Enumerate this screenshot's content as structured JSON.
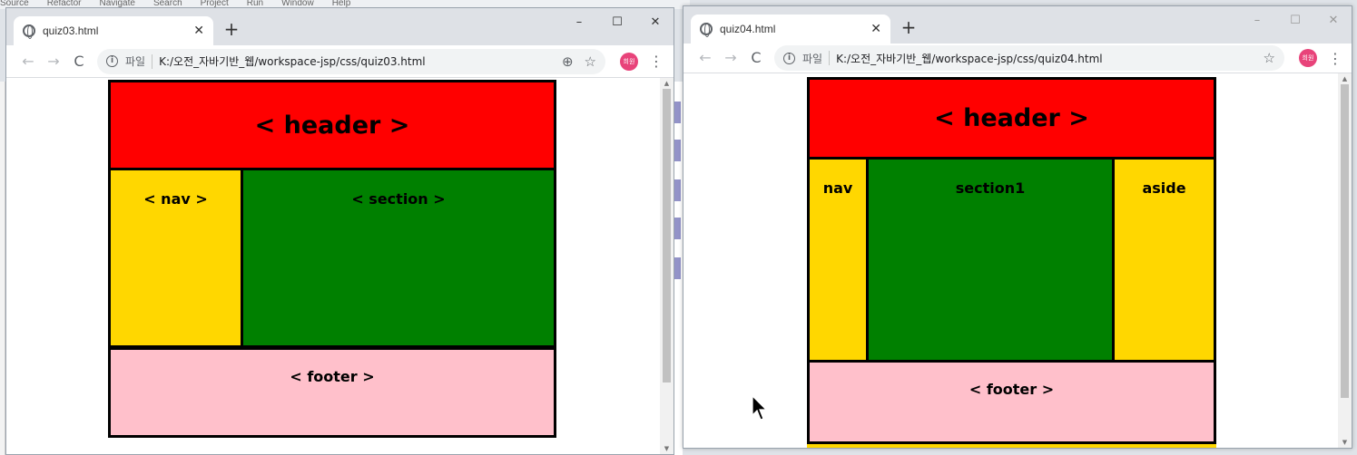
{
  "ide": {
    "menu": [
      "Source",
      "Refactor",
      "Navigate",
      "Search",
      "Project",
      "Run",
      "Window",
      "Help"
    ]
  },
  "window1": {
    "tab_title": "quiz03.html",
    "new_tab": "+",
    "minimize": "–",
    "maximize": "☐",
    "close": "✕",
    "back": "←",
    "forward": "→",
    "reload": "C",
    "scheme": "파일",
    "url": "K:/오전_자바기반_웹/workspace-jsp/css/quiz03.html",
    "zoom_icon": "⊕",
    "star_icon": "☆",
    "avatar": "희원",
    "menu": "⋮",
    "page": {
      "header": "< header >",
      "nav": "< nav >",
      "section": "< section >",
      "footer": "< footer >"
    }
  },
  "window2": {
    "tab_title": "quiz04.html",
    "new_tab": "+",
    "minimize": "–",
    "maximize": "☐",
    "close": "✕",
    "back": "←",
    "forward": "→",
    "reload": "C",
    "scheme": "파일",
    "url": "K:/오전_자바기반_웹/workspace-jsp/css/quiz04.html",
    "star_icon": "☆",
    "avatar": "희원",
    "menu": "⋮",
    "page": {
      "header": "< header >",
      "nav": "nav",
      "section": "section1",
      "aside": "aside",
      "footer": "< footer >"
    }
  },
  "colors": {
    "header": "#ff0000",
    "nav": "#ffd700",
    "section": "#008000",
    "aside": "#ffd700",
    "footer": "#ffc0cb"
  }
}
